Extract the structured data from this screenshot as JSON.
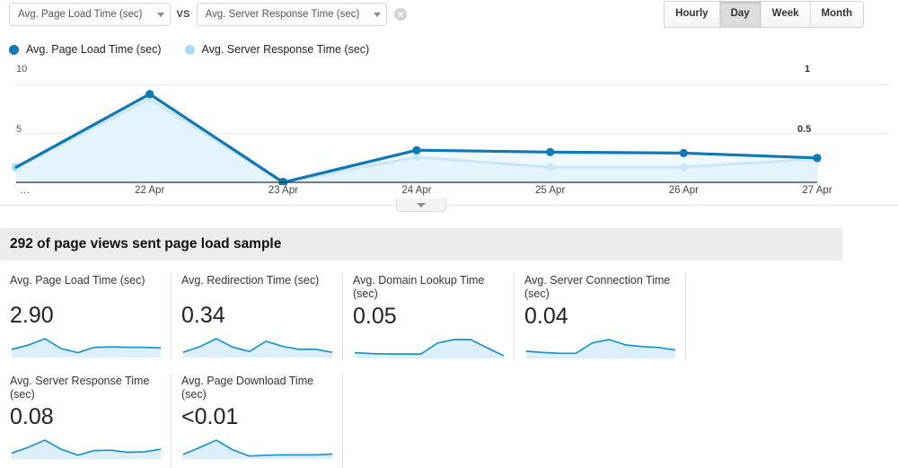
{
  "toolbar": {
    "metric_primary": "Avg. Page Load Time (sec)",
    "metric_secondary": "Avg. Server Response Time (sec)",
    "vs_label": "VS",
    "remove_icon": "remove-circle-icon",
    "periods": [
      {
        "label": "Hourly",
        "active": false
      },
      {
        "label": "Day",
        "active": true
      },
      {
        "label": "Week",
        "active": false
      },
      {
        "label": "Month",
        "active": false
      }
    ]
  },
  "legend": [
    {
      "label": "Avg. Page Load Time (sec)",
      "color": "#1078b4"
    },
    {
      "label": "Avg. Server Response Time (sec)",
      "color": "#a9dcf2"
    }
  ],
  "chart_data": {
    "type": "line",
    "title": "",
    "xlabel": "",
    "ylabel": "",
    "grid": true,
    "legend_position": "top-left",
    "x": [
      "…",
      "22 Apr",
      "23 Apr",
      "24 Apr",
      "25 Apr",
      "26 Apr",
      "27 Apr"
    ],
    "left_axis": {
      "ticks": [
        5,
        10
      ],
      "ylim": [
        0,
        11.6
      ],
      "series_name": "Avg. Page Load Time (sec)"
    },
    "right_axis": {
      "ticks": [
        0.5,
        1
      ],
      "ylim": [
        0,
        1.16
      ],
      "series_name": "Avg. Server Response Time (sec)"
    },
    "series": [
      {
        "name": "Avg. Page Load Time (sec)",
        "color": "#1078b4",
        "axis": "left",
        "values": [
          1.55,
          9.05,
          0.0,
          3.3,
          3.1,
          3.0,
          2.5
        ]
      },
      {
        "name": "Avg. Server Response Time (sec)",
        "color": "#a9dcf2",
        "axis": "right",
        "values": [
          0.155,
          0.855,
          0.0,
          0.26,
          0.155,
          0.155,
          0.24
        ]
      }
    ],
    "collapse_toggle_icon": "chevron-down-icon"
  },
  "sample_banner": {
    "text": "292 of page views sent page load sample"
  },
  "cards": [
    {
      "title": "Avg. Page Load Time (sec)",
      "value": "2.90",
      "spark": [
        2.0,
        3.2,
        5.0,
        2.2,
        1.1,
        2.6,
        2.7,
        2.6,
        2.6,
        2.4
      ]
    },
    {
      "title": "Avg. Redirection Time (sec)",
      "value": "0.34",
      "spark": [
        1.0,
        2.3,
        4.2,
        2.2,
        1.2,
        3.6,
        2.4,
        1.7,
        1.7,
        1.0
      ]
    },
    {
      "title": "Avg. Domain Lookup Time (sec)",
      "value": "0.05",
      "spark": [
        1.1,
        0.9,
        0.8,
        0.8,
        0.8,
        3.3,
        4.1,
        4.1,
        2.2,
        0.4
      ]
    },
    {
      "title": "Avg. Server Connection Time (sec)",
      "value": "0.04",
      "spark": [
        1.5,
        1.2,
        1.0,
        1.0,
        3.5,
        4.3,
        3.0,
        2.6,
        2.4,
        1.8
      ]
    },
    {
      "title": "Avg. Server Response Time (sec)",
      "value": "0.08",
      "spark": [
        1.2,
        2.6,
        4.3,
        2.1,
        0.7,
        1.8,
        1.9,
        1.4,
        1.5,
        2.1
      ]
    },
    {
      "title": "Avg. Page Download Time (sec)",
      "value": "<0.01",
      "spark": [
        0.9,
        2.6,
        4.4,
        2.0,
        0.5,
        0.7,
        0.8,
        0.8,
        0.8,
        1.0
      ]
    }
  ],
  "colors": {
    "line_primary": "#1078b4",
    "line_secondary": "#a9dcf2",
    "area_fill": "#e3f2fb",
    "spark_line": "#1b93d1",
    "spark_fill": "#ddeffa"
  }
}
